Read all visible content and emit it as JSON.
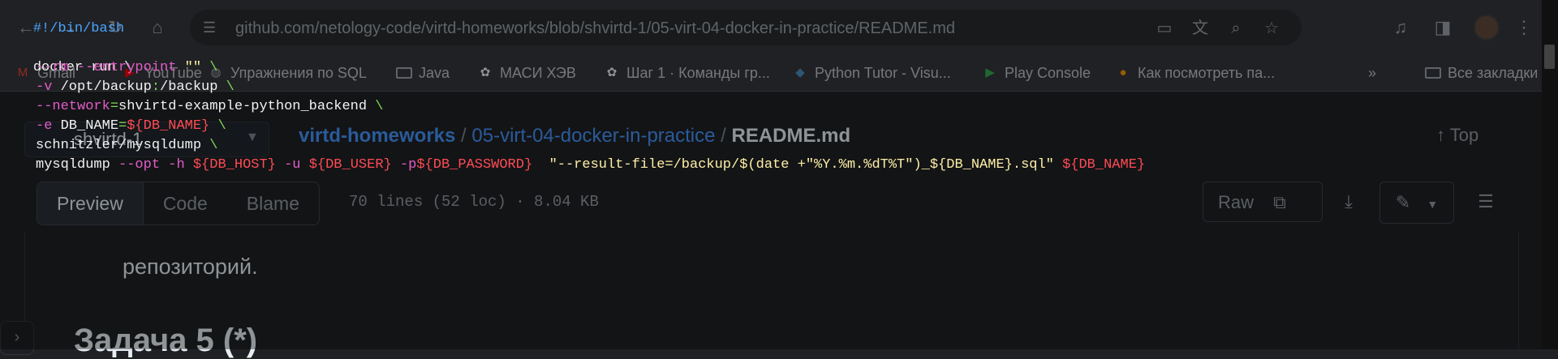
{
  "browser": {
    "url": "github.com/netology-code/virtd-homeworks/blob/shvirtd-1/05-virt-04-docker-in-practice/README.md",
    "nav": {
      "back": "←",
      "forward": "→",
      "reload": "↻",
      "home": "⌂"
    },
    "bookmarks": [
      {
        "label": "Gmail",
        "icon": "gmail-icon"
      },
      {
        "label": "YouTube",
        "icon": "youtube-icon"
      },
      {
        "label": "Упражнения по SQL",
        "icon": "globe-icon"
      },
      {
        "label": "Java",
        "icon": "folder-icon"
      },
      {
        "label": "МАСИ ХЭВ",
        "icon": "chatgpt-icon"
      },
      {
        "label": "Шаг 1 · Команды гр...",
        "icon": "chatgpt-icon"
      },
      {
        "label": "Python Tutor - Visu...",
        "icon": "python-icon"
      },
      {
        "label": "Play Console",
        "icon": "play-console-icon"
      },
      {
        "label": "Как посмотреть па...",
        "icon": "cookie-icon"
      }
    ],
    "bookmarks_overflow": "»",
    "all_bookmarks": "Все закладки"
  },
  "github": {
    "branch_label": "shvirtd-1",
    "breadcrumb": {
      "repo": "virtd-homeworks",
      "sep1": "/",
      "folder": "05-virt-04-docker-in-practice",
      "sep2": "/",
      "file": "README.md"
    },
    "top_link": "↑ Top",
    "tabs": [
      "Preview",
      "Code",
      "Blame"
    ],
    "active_tab": "Preview",
    "file_meta": "70 lines (52 loc) · 8.04 KB",
    "raw_label": "Raw",
    "content": {
      "paragraph_end": "репозиторий.",
      "heading": "Задача 5 (*)"
    }
  },
  "code_overlay": {
    "line1": "#!/bin/bash",
    "line3": "docker run \\",
    "line4": {
      "flag": "--rm --entrypoint",
      "str": " \"\"",
      "bs": " \\"
    },
    "line5": {
      "flag": "-v",
      "txt": " /opt/backup",
      "sep": ":",
      "txt2": "/backup",
      "bs": " \\"
    },
    "line6": {
      "flag": "--network",
      "eq": "=",
      "txt": "shvirtd-example-python_backend",
      "bs": " \\"
    },
    "line7": {
      "flag": "-e",
      "txt": " DB_NAME",
      "eq": "=",
      "var": "${DB_NAME}",
      "bs": " \\"
    },
    "line8": {
      "txt": "schnitzler/mysqldump",
      "bs": " \\"
    },
    "line9": {
      "cmd": "mysqldump ",
      "f1": "--opt -h ",
      "v1": "${DB_HOST}",
      "f2": " -u ",
      "v2": "${DB_USER}",
      "f3": " -p",
      "v3": "${DB_PASSWORD}",
      "s1": "  \"--result-file=/backup/$(date +\"%Y.%m.%dT%T\")_${DB_NAME}.sql\" ",
      "v4": "${DB_NAME}"
    }
  }
}
